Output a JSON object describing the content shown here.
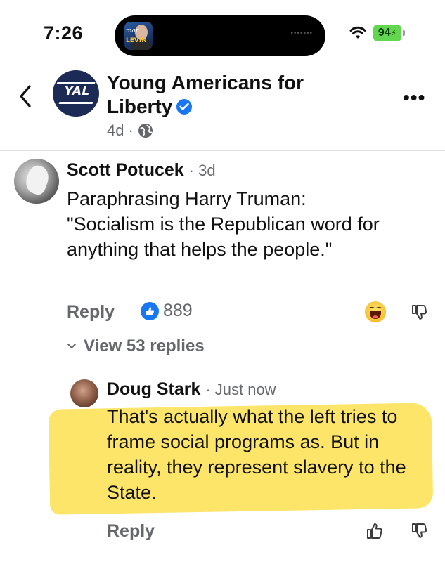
{
  "status_bar": {
    "time": "7:26",
    "island_thumb_line1": "mar",
    "island_thumb_line2": "LEVIN",
    "island_dots": "•••••••",
    "battery": "94"
  },
  "post": {
    "page_name": "Young Americans for Liberty",
    "avatar_text": "YAL",
    "age": "4d",
    "separator": "·",
    "more_icon": "•••"
  },
  "comments": [
    {
      "author": "Scott Potucek",
      "time": "· 3d",
      "text": "Paraphrasing Harry Truman:\n\"Socialism is the Republican word for anything that helps the people.\"",
      "reply_label": "Reply",
      "like_count": "889",
      "view_replies": "View 53 replies"
    },
    {
      "author": "Doug Stark",
      "time": "· Just now",
      "text": "That's actually what the left tries to frame social programs as. But in reality, they represent slavery to the State.",
      "reply_label": "Reply"
    }
  ],
  "colors": {
    "accent": "#1877f2",
    "highlight": "#fbe14d",
    "secondary_text": "#65676b"
  }
}
